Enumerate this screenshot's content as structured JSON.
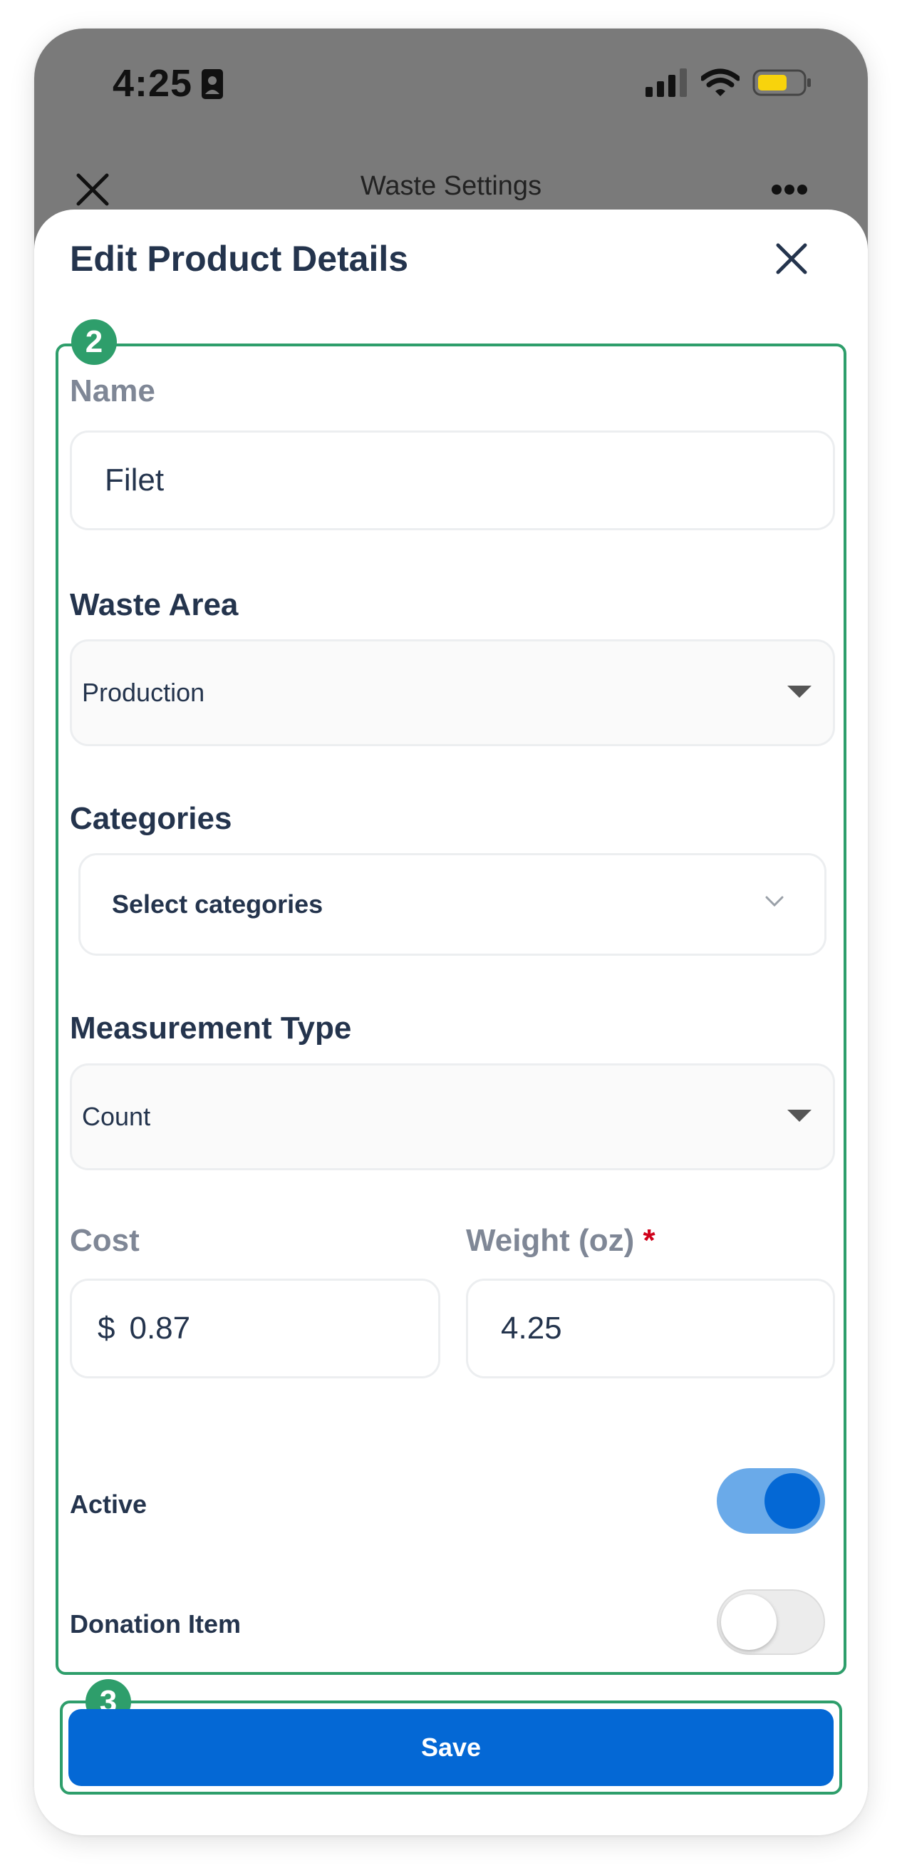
{
  "status_bar": {
    "time": "4:25"
  },
  "nav": {
    "title": "Waste Settings"
  },
  "sheet": {
    "title": "Edit Product Details"
  },
  "annotations": {
    "form_badge": "2",
    "save_badge": "3",
    "color": "#2e9e6b"
  },
  "form": {
    "name": {
      "label": "Name",
      "value": "Filet"
    },
    "waste_area": {
      "label": "Waste Area",
      "selected": "Production"
    },
    "categories": {
      "label": "Categories",
      "placeholder": "Select categories"
    },
    "measurement_type": {
      "label": "Measurement Type",
      "selected": "Count"
    },
    "cost": {
      "label": "Cost",
      "currency_symbol": "$",
      "value": "0.87"
    },
    "weight": {
      "label": "Weight (oz)",
      "required_mark": "*",
      "value": "4.25"
    },
    "active": {
      "label": "Active",
      "on": true
    },
    "donation_item": {
      "label": "Donation Item",
      "on": false
    }
  },
  "actions": {
    "save_label": "Save"
  },
  "colors": {
    "primary": "#0468d5",
    "toggle_on_track": "#6aaae9",
    "heading": "#24344d",
    "muted_label": "#7f8796"
  }
}
